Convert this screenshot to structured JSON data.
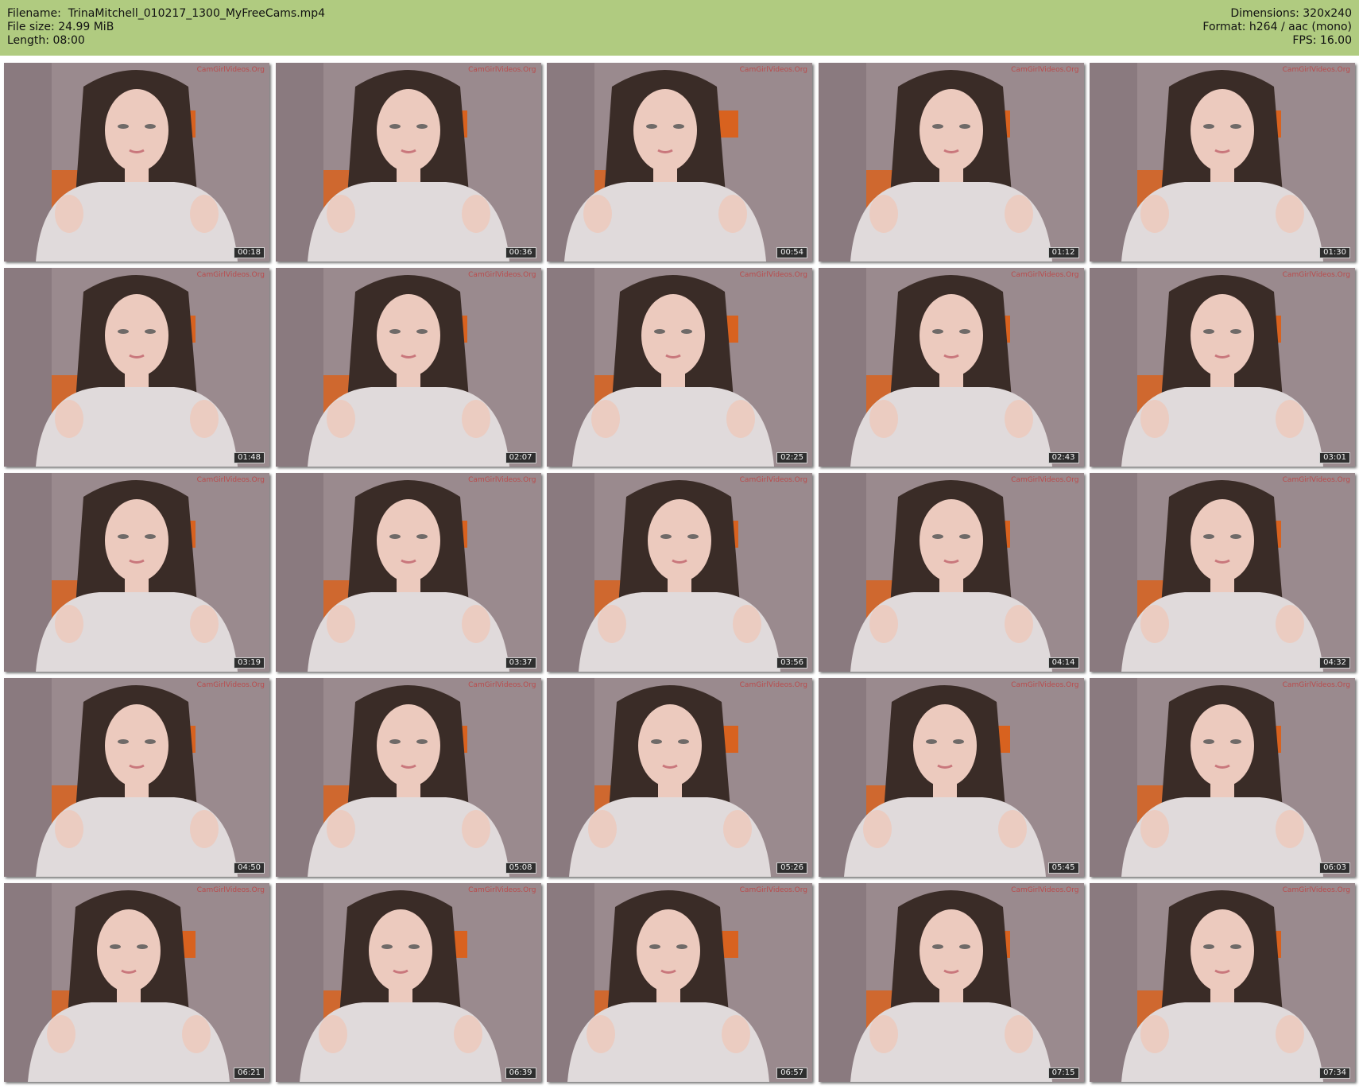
{
  "header": {
    "filename_label": "Filename:",
    "filename": "TrinaMitchell_010217_1300_MyFreeCams.mp4",
    "filesize_label": "File size:",
    "filesize": "24.99 MiB",
    "length_label": "Length:",
    "length": "08:00",
    "dimensions_label": "Dimensions:",
    "dimensions": "320x240",
    "format_label": "Format:",
    "format": "h264 / aac (mono)",
    "fps_label": "FPS:",
    "fps": "16.00"
  },
  "watermark": "CamGirlVideos.Org",
  "thumbnails": [
    {
      "timestamp": "00:18"
    },
    {
      "timestamp": "00:36"
    },
    {
      "timestamp": "00:54"
    },
    {
      "timestamp": "01:12"
    },
    {
      "timestamp": "01:30"
    },
    {
      "timestamp": "01:48"
    },
    {
      "timestamp": "02:07"
    },
    {
      "timestamp": "02:25"
    },
    {
      "timestamp": "02:43"
    },
    {
      "timestamp": "03:01"
    },
    {
      "timestamp": "03:19"
    },
    {
      "timestamp": "03:37"
    },
    {
      "timestamp": "03:56"
    },
    {
      "timestamp": "04:14"
    },
    {
      "timestamp": "04:32"
    },
    {
      "timestamp": "04:50"
    },
    {
      "timestamp": "05:08"
    },
    {
      "timestamp": "05:26"
    },
    {
      "timestamp": "05:45"
    },
    {
      "timestamp": "06:03"
    },
    {
      "timestamp": "06:21"
    },
    {
      "timestamp": "06:39"
    },
    {
      "timestamp": "06:57"
    },
    {
      "timestamp": "07:15"
    },
    {
      "timestamp": "07:34"
    }
  ],
  "colors": {
    "header_bg": "#b0cb80",
    "wall": "#9a8a8e",
    "shelf": "#d8621f",
    "hair": "#3a2c27",
    "hair_tips": "#b89a56",
    "skin": "#eccabe",
    "top": "#e0dadb"
  }
}
